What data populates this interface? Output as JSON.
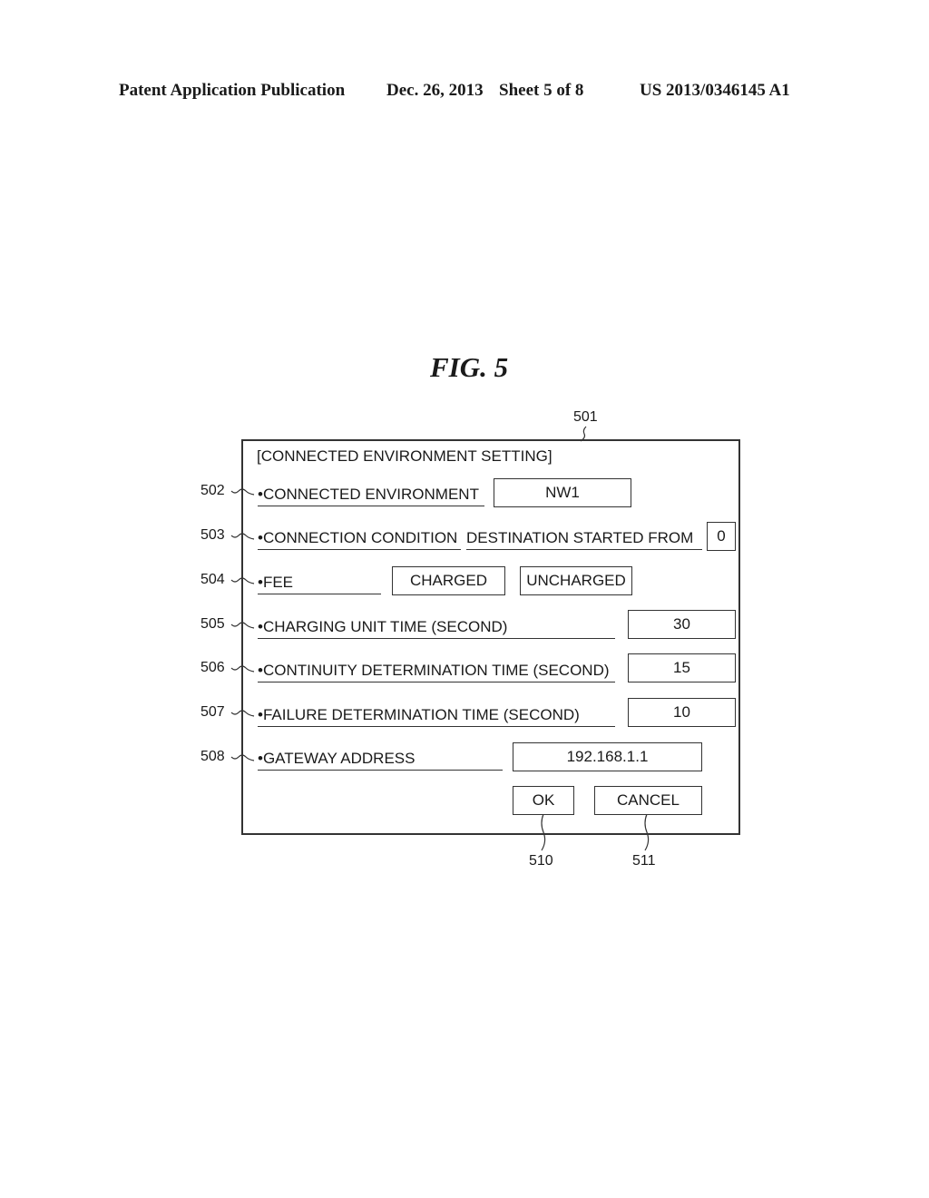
{
  "header": {
    "publication": "Patent Application Publication",
    "date": "Dec. 26, 2013",
    "sheet": "Sheet 5 of 8",
    "number": "US 2013/0346145 A1"
  },
  "figure": {
    "title": "FIG. 5"
  },
  "dialog": {
    "ref": "501",
    "title": "[CONNECTED ENVIRONMENT SETTING]",
    "rows": [
      {
        "ref": "502",
        "label": "•CONNECTED ENVIRONMENT",
        "value": "NW1"
      },
      {
        "ref": "503",
        "label": "•CONNECTION CONDITION",
        "label2": "DESTINATION STARTED FROM",
        "value": "0"
      },
      {
        "ref": "504",
        "label": "•FEE",
        "option1": "CHARGED",
        "option2": "UNCHARGED"
      },
      {
        "ref": "505",
        "label": "•CHARGING UNIT TIME (SECOND)",
        "value": "30"
      },
      {
        "ref": "506",
        "label": "•CONTINUITY DETERMINATION TIME (SECOND)",
        "value": "15"
      },
      {
        "ref": "507",
        "label": "•FAILURE DETERMINATION TIME (SECOND)",
        "value": "10"
      },
      {
        "ref": "508",
        "label": "•GATEWAY ADDRESS",
        "value": "192.168.1.1"
      }
    ],
    "ok": {
      "label": "OK",
      "ref": "510"
    },
    "cancel": {
      "label": "CANCEL",
      "ref": "511"
    }
  }
}
